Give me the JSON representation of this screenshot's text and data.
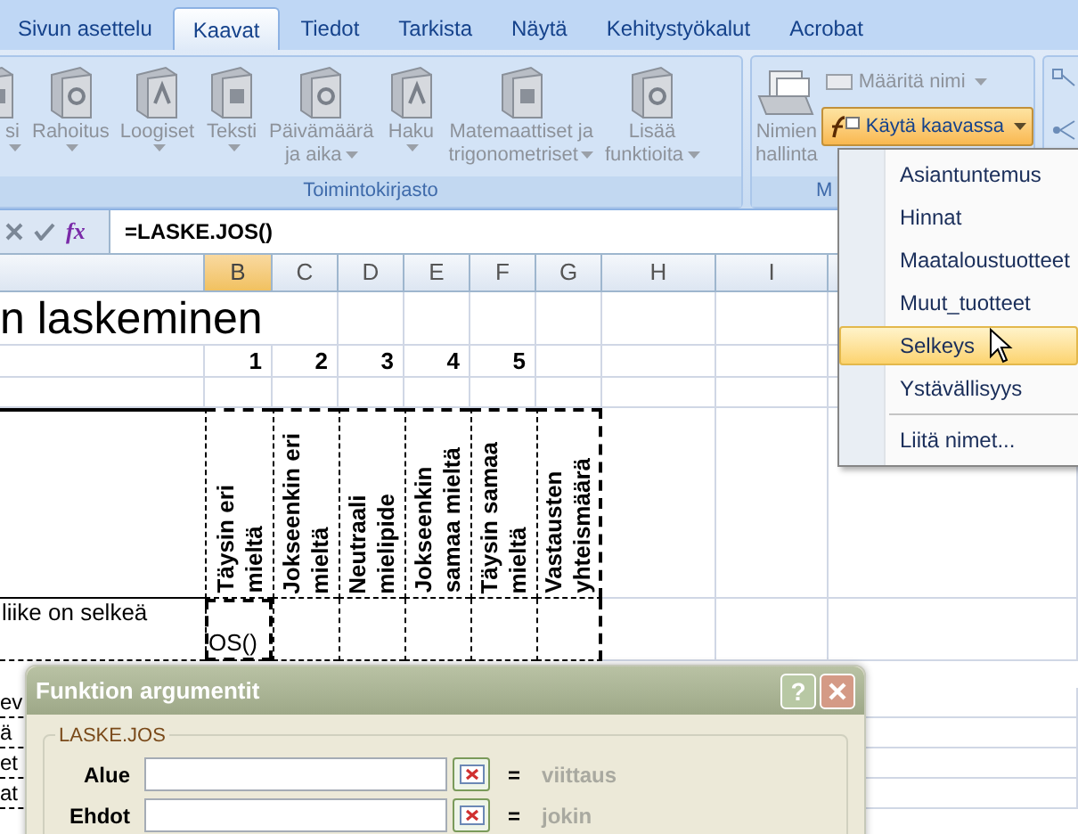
{
  "tabs": [
    {
      "label": "Sivun asettelu",
      "selected": false
    },
    {
      "label": "Kaavat",
      "selected": true
    },
    {
      "label": "Tiedot",
      "selected": false
    },
    {
      "label": "Tarkista",
      "selected": false
    },
    {
      "label": "Näytä",
      "selected": false
    },
    {
      "label": "Kehitystyökalut",
      "selected": false
    },
    {
      "label": "Acrobat",
      "selected": false
    }
  ],
  "function_library": {
    "label": "Toimintokirjasto",
    "buttons": [
      {
        "lines": [
          "si"
        ],
        "disabled": true
      },
      {
        "lines": [
          "Rahoitus"
        ],
        "disabled": true
      },
      {
        "lines": [
          "Loogiset"
        ],
        "disabled": true
      },
      {
        "lines": [
          "Teksti"
        ],
        "disabled": true
      },
      {
        "lines": [
          "Päivämäärä",
          "ja aika"
        ],
        "disabled": true
      },
      {
        "lines": [
          "Haku"
        ],
        "disabled": true
      },
      {
        "lines": [
          "Matemaattiset ja",
          "trigonometriset"
        ],
        "disabled": true
      },
      {
        "lines": [
          "Lisää",
          "funktioita"
        ],
        "disabled": true
      }
    ]
  },
  "defined_names": {
    "label": "M",
    "name_manager": {
      "lines": [
        "Nimien",
        "hallinta"
      ],
      "disabled": true
    },
    "define_name": {
      "label": "Määritä nimi",
      "disabled": true
    },
    "use_in_formula": {
      "label": "Käytä kaavassa",
      "active": true
    }
  },
  "formula_bar": {
    "fx": "fx",
    "formula": "=LASKE.JOS()"
  },
  "sheet": {
    "columns": [
      {
        "label": "B",
        "selected": true
      },
      {
        "label": "C",
        "selected": false
      },
      {
        "label": "D",
        "selected": false
      },
      {
        "label": "E",
        "selected": false
      },
      {
        "label": "F",
        "selected": false
      },
      {
        "label": "G",
        "selected": false
      },
      {
        "label": "H",
        "selected": false
      },
      {
        "label": "I",
        "selected": false
      }
    ],
    "title": "n laskeminen",
    "scale": [
      "1",
      "2",
      "3",
      "4",
      "5"
    ],
    "headers": [
      [
        "Täysin eri",
        "mieltä"
      ],
      [
        "Jokseenkin eri",
        "mieltä"
      ],
      [
        "Neutraali",
        "mielipide"
      ],
      [
        "Jokseenkin",
        "samaa mieltä"
      ],
      [
        "Täysin samaa",
        "mieltä"
      ],
      [
        "Vastausten",
        "yhteismäärä"
      ]
    ],
    "rows": [
      {
        "label": "liike on selkeä",
        "value": "OS()"
      },
      {
        "label": "ev"
      },
      {
        "label": "ä"
      },
      {
        "label": "et"
      },
      {
        "label": "at"
      }
    ]
  },
  "menu": {
    "items": [
      {
        "kind": "name",
        "label": "Asiantuntemus",
        "selected": false
      },
      {
        "kind": "name",
        "label": "Hinnat",
        "selected": false
      },
      {
        "kind": "name",
        "label": "Maataloustuotteet",
        "selected": false
      },
      {
        "kind": "name",
        "label": "Muut_tuotteet",
        "selected": false
      },
      {
        "kind": "name",
        "label": "Selkeys",
        "selected": true
      },
      {
        "kind": "name",
        "label": "Ystävällisyys",
        "selected": false
      },
      {
        "kind": "command",
        "label": "Liitä nimet...",
        "selected": false
      }
    ]
  },
  "dialog": {
    "title": "Funktion argumentit",
    "help": "?",
    "group": "LASKE.JOS",
    "fields": [
      {
        "label": "Alue",
        "sign": "=",
        "result": "viittaus"
      },
      {
        "label": "Ehdot",
        "sign": "=",
        "result": "jokin"
      }
    ]
  }
}
